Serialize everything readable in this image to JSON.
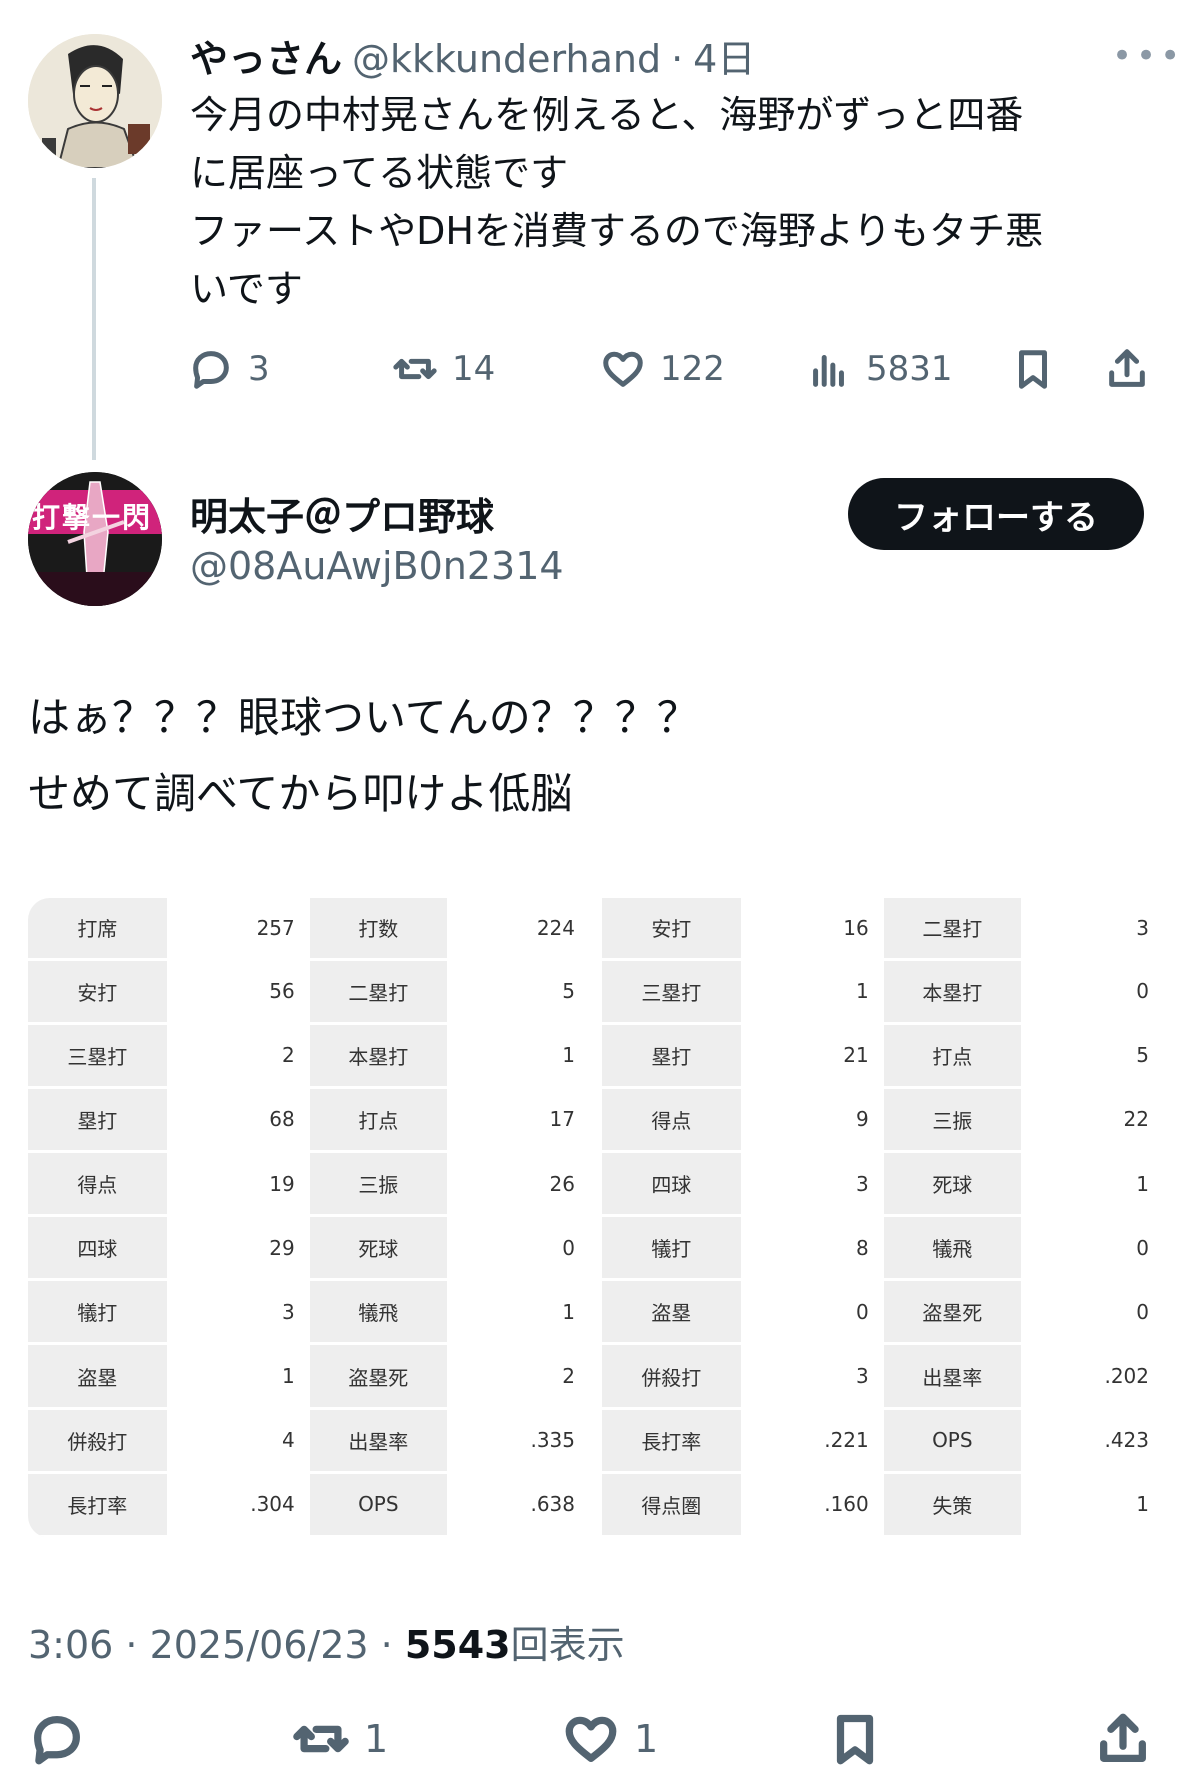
{
  "parent": {
    "name": "やっさん",
    "handle": "@kkkunderhand",
    "separator": "·",
    "time": "4日",
    "more": "•••",
    "text": "今月の中村晃さんを例えると、海野がずっと四番\nに居座ってる状態です\nファーストやDHを消費するので海野よりもタチ悪\nいです",
    "actions": {
      "replies": "3",
      "reposts": "14",
      "likes": "122",
      "views": "5831"
    }
  },
  "main": {
    "name": "明太子＠プロ野球",
    "handle": "@08AuAwjB0n2314",
    "follow_label": "フォローする",
    "avatar_text": "打撃一閃",
    "text": "はぁ？？？眼球ついてんの？？？？\nせめて調べてから叩けよ低脳",
    "timestamp": "3:06 · 2025/06/23 · ",
    "views_count": "5543",
    "views_label": "回表示",
    "actions": {
      "replies": "",
      "reposts": "1",
      "likes": "1"
    }
  },
  "stats_left": [
    [
      "打席",
      "257",
      "打数",
      "224"
    ],
    [
      "安打",
      "56",
      "二塁打",
      "5"
    ],
    [
      "三塁打",
      "2",
      "本塁打",
      "1"
    ],
    [
      "塁打",
      "68",
      "打点",
      "17"
    ],
    [
      "得点",
      "19",
      "三振",
      "26"
    ],
    [
      "四球",
      "29",
      "死球",
      "0"
    ],
    [
      "犠打",
      "3",
      "犠飛",
      "1"
    ],
    [
      "盗塁",
      "1",
      "盗塁死",
      "2"
    ],
    [
      "併殺打",
      "4",
      "出塁率",
      ".335"
    ],
    [
      "長打率",
      ".304",
      "OPS",
      ".638"
    ]
  ],
  "stats_right": [
    [
      "安打",
      "16",
      "二塁打",
      "3"
    ],
    [
      "三塁打",
      "1",
      "本塁打",
      "0"
    ],
    [
      "塁打",
      "21",
      "打点",
      "5"
    ],
    [
      "得点",
      "9",
      "三振",
      "22"
    ],
    [
      "四球",
      "3",
      "死球",
      "1"
    ],
    [
      "犠打",
      "8",
      "犠飛",
      "0"
    ],
    [
      "盗塁",
      "0",
      "盗塁死",
      "0"
    ],
    [
      "併殺打",
      "3",
      "出塁率",
      ".202"
    ],
    [
      "長打率",
      ".221",
      "OPS",
      ".423"
    ],
    [
      "得点圏",
      ".160",
      "失策",
      "1"
    ]
  ],
  "icons": {
    "reply": "reply-icon",
    "repost": "repost-icon",
    "like": "heart-icon",
    "views": "views-icon",
    "bookmark": "bookmark-icon",
    "share": "share-icon"
  },
  "colors": {
    "text": "#0f1419",
    "muted": "#536471",
    "follow_bg": "#0f1419",
    "avatar_pink": "#d0237b"
  }
}
